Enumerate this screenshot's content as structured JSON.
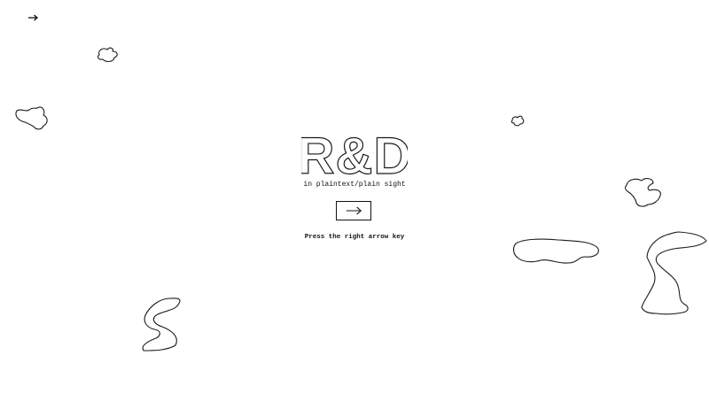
{
  "page": {
    "title": "R&D",
    "subtitle": "in plaintext/plain sight",
    "hint": "Press the right arrow key"
  },
  "controls": {
    "next_icon": "right-arrow-icon",
    "corner_icon": "right-arrow-icon"
  },
  "colors": {
    "background": "#ffffff",
    "ink": "#1a1a1a"
  }
}
